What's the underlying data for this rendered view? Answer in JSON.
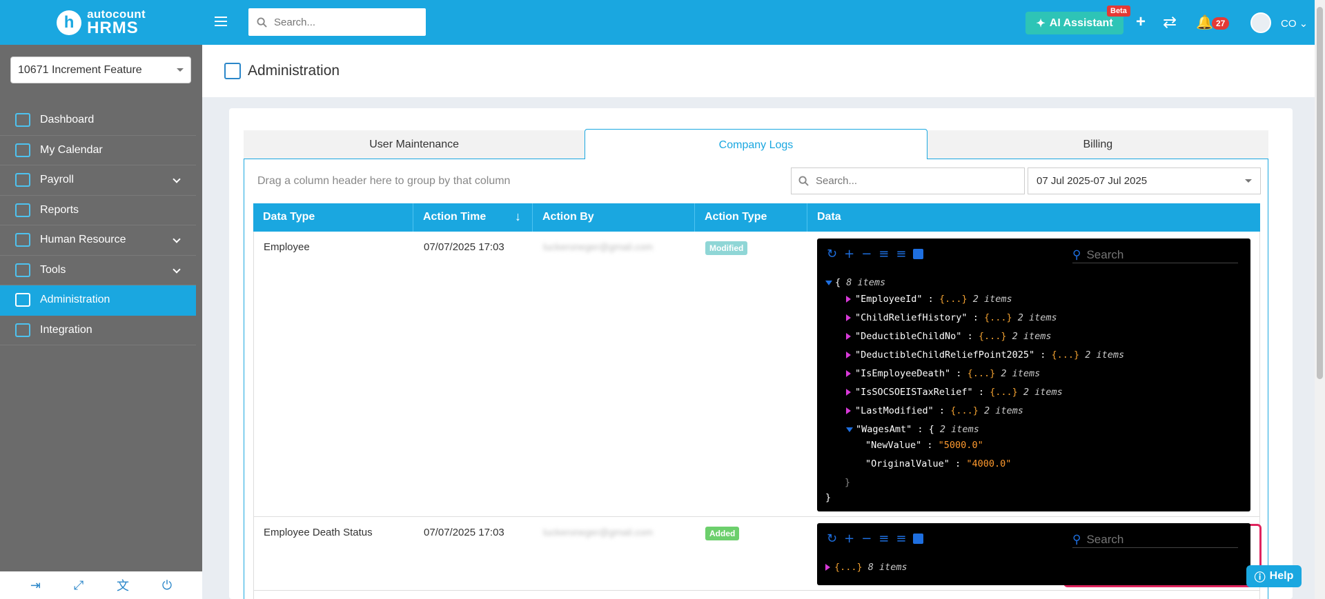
{
  "brand": {
    "line1": "autocount",
    "line2": "HRMS"
  },
  "company": {
    "selected": "10671 Increment Feature"
  },
  "sidebar": {
    "items": [
      {
        "label": "Dashboard"
      },
      {
        "label": "My Calendar"
      },
      {
        "label": "Payroll"
      },
      {
        "label": "Reports"
      },
      {
        "label": "Human Resource"
      },
      {
        "label": "Tools"
      },
      {
        "label": "Administration"
      },
      {
        "label": "Integration"
      }
    ]
  },
  "topbar": {
    "search_placeholder": "Search...",
    "ai_label": "AI Assistant",
    "beta": "Beta",
    "notifications": "27",
    "user": "CO"
  },
  "page": {
    "title": "Administration"
  },
  "tabs": [
    "User Maintenance",
    "Company Logs",
    "Billing"
  ],
  "grid": {
    "group_hint": "Drag a column header here to group by that column",
    "search_placeholder": "Search...",
    "date_range": "07 Jul 2025-07 Jul 2025",
    "columns": [
      "Data Type",
      "Action Time",
      "Action By",
      "Action Type",
      "Data"
    ],
    "rows": [
      {
        "data_type": "Employee",
        "action_time": "07/07/2025 17:03",
        "action_by": "luckeroneger@gmail.com",
        "action_type": "Modified"
      },
      {
        "data_type": "Employee Death Status",
        "action_time": "07/07/2025 17:03",
        "action_by": "luckeroneger@gmail.com",
        "action_type": "Added"
      }
    ]
  },
  "json_viewer": {
    "search_placeholder": "Search",
    "root_count": "8 items",
    "items_suffix": "2 items",
    "ellipsis": "{...}",
    "keys": [
      "\"EmployeeId\"",
      "\"ChildReliefHistory\"",
      "\"DeductibleChildNo\"",
      "\"DeductibleChildReliefPoint2025\"",
      "\"IsEmployeeDeath\"",
      "\"IsSOCSOEISTaxRelief\"",
      "\"LastModified\""
    ],
    "expanded_key": "\"WagesAmt\"",
    "new_value_key": "\"NewValue\"",
    "new_value": "\"5000.0\"",
    "original_value_key": "\"OriginalValue\"",
    "original_value": "\"4000.0\"",
    "row2_count": "8 items"
  },
  "help": "Help"
}
